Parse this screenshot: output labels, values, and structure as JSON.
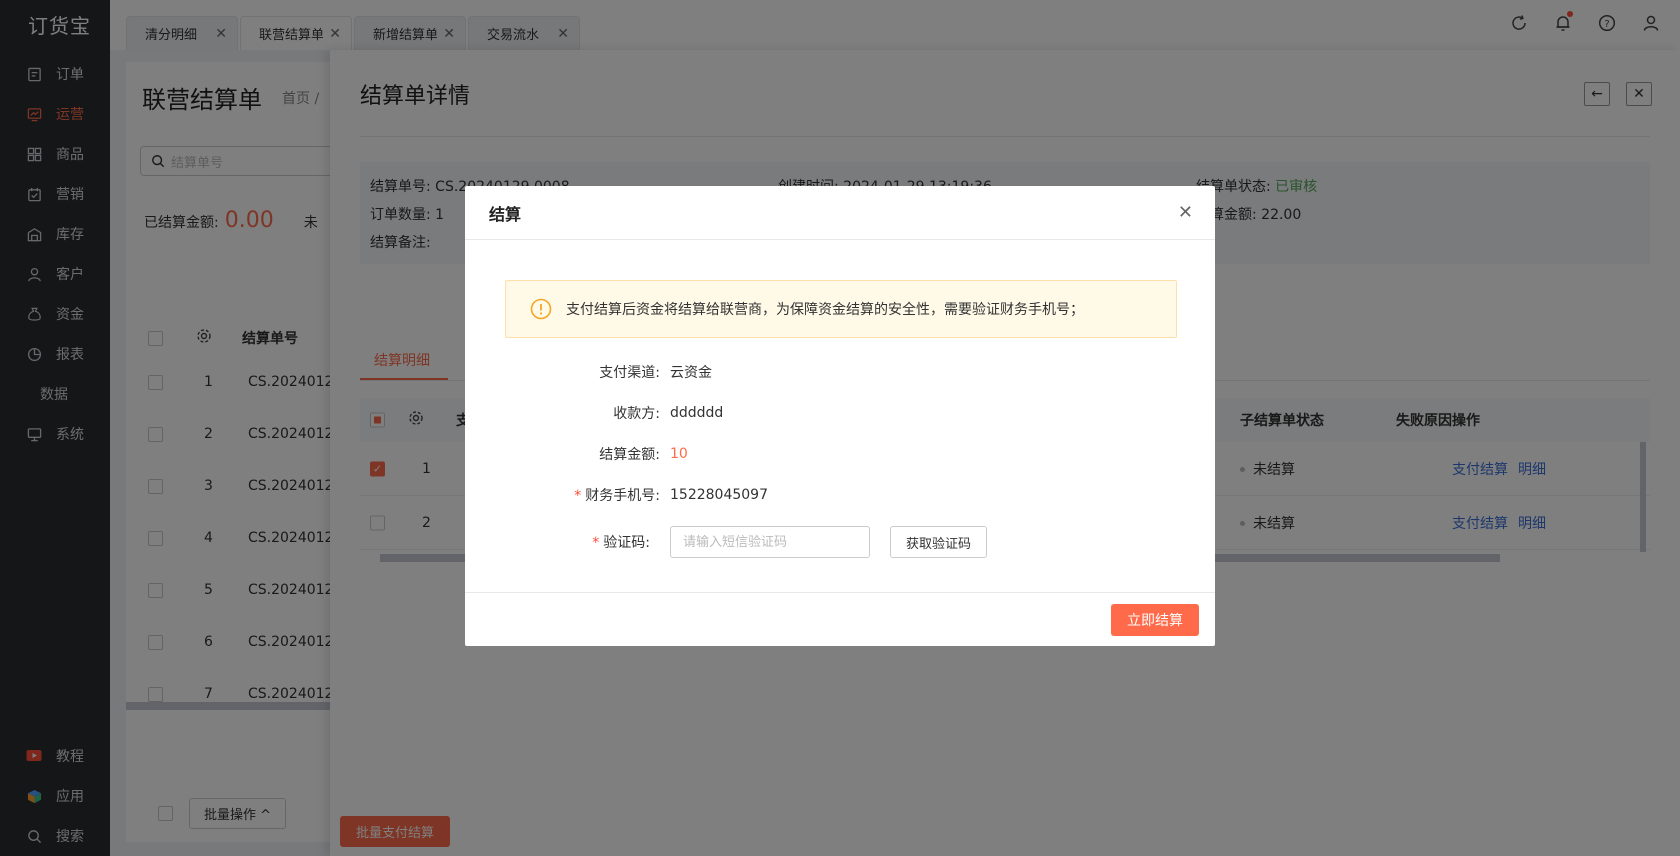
{
  "app": {
    "logo": "订货宝"
  },
  "sidebar": {
    "items": [
      {
        "label": "订单",
        "icon": "order-icon"
      },
      {
        "label": "运营",
        "icon": "operation-icon",
        "active": true
      },
      {
        "label": "商品",
        "icon": "goods-icon"
      },
      {
        "label": "营销",
        "icon": "marketing-icon"
      },
      {
        "label": "库存",
        "icon": "warehouse-icon"
      },
      {
        "label": "客户",
        "icon": "user-icon"
      },
      {
        "label": "资金",
        "icon": "money-bag-icon"
      },
      {
        "label": "报表",
        "icon": "pie-chart-icon"
      },
      {
        "label": "数据",
        "icon": ""
      },
      {
        "label": "系统",
        "icon": "monitor-icon"
      }
    ],
    "bottom": [
      {
        "label": "教程",
        "icon": "video-icon"
      },
      {
        "label": "应用",
        "icon": "cube-icon"
      },
      {
        "label": "搜索",
        "icon": "search-icon"
      }
    ]
  },
  "tabs": [
    {
      "label": "清分明细"
    },
    {
      "label": "联营结算单",
      "active": true
    },
    {
      "label": "新增结算单"
    },
    {
      "label": "交易流水"
    }
  ],
  "list_page": {
    "title": "联营结算单",
    "breadcrumb": "首页 /",
    "search_placeholder": "结算单号",
    "settled_label": "已结算金额:",
    "settled_value": "0.00",
    "unsettled_label": "未",
    "column_header": "结算单号",
    "rows": [
      {
        "num": "1",
        "code": "CS.2024012"
      },
      {
        "num": "2",
        "code": "CS.2024012"
      },
      {
        "num": "3",
        "code": "CS.2024012"
      },
      {
        "num": "4",
        "code": "CS.2024012"
      },
      {
        "num": "5",
        "code": "CS.2024012"
      },
      {
        "num": "6",
        "code": "CS.2024012"
      },
      {
        "num": "7",
        "code": "CS.2024012"
      }
    ],
    "batch_label": "批量操作"
  },
  "detail": {
    "title": "结算单详情",
    "info": {
      "no_label": "结算单号:",
      "no_value": "CS.20240129.0008",
      "created_label": "创建时间:",
      "created_value": "2024-01-29 13:19:36",
      "status_label": "结算单状态:",
      "status_value": "已审核",
      "order_count_label": "订单数量:",
      "order_count_value": "1",
      "amount_label": "结算金额:",
      "amount_value": "22.00",
      "remark_label": "结算备注:"
    },
    "tab": "结算明细",
    "table": {
      "col_pay": "支",
      "col_sub_status": "子结算单状态",
      "col_fail": "失败原因",
      "col_ops": "操作",
      "rows": [
        {
          "num": "1",
          "checked": true,
          "status": "未结算",
          "action1": "支付结算",
          "action2": "明细"
        },
        {
          "num": "2",
          "checked": false,
          "status": "未结算",
          "action1": "支付结算",
          "action2": "明细"
        }
      ]
    },
    "batch_pay": "批量支付结算"
  },
  "modal": {
    "title": "结算",
    "alert": "支付结算后资金将结算给联营商，为保障资金结算的安全性，需要验证财务手机号；",
    "channel_label": "支付渠道:",
    "channel_value": "云资金",
    "payee_label": "收款方:",
    "payee_value": "dddddd",
    "amount_label": "结算金额:",
    "amount_value": "10",
    "phone_label": "财务手机号:",
    "phone_value": "15228045097",
    "code_label": "验证码:",
    "code_placeholder": "请输入短信验证码",
    "get_code": "获取验证码",
    "confirm": "立即结算",
    "required_mark": "*"
  },
  "colors": {
    "accent": "#ff6b4a",
    "sidebar_bg": "#2b2d31",
    "link": "#3b6fd8",
    "approved": "#52a85a"
  }
}
